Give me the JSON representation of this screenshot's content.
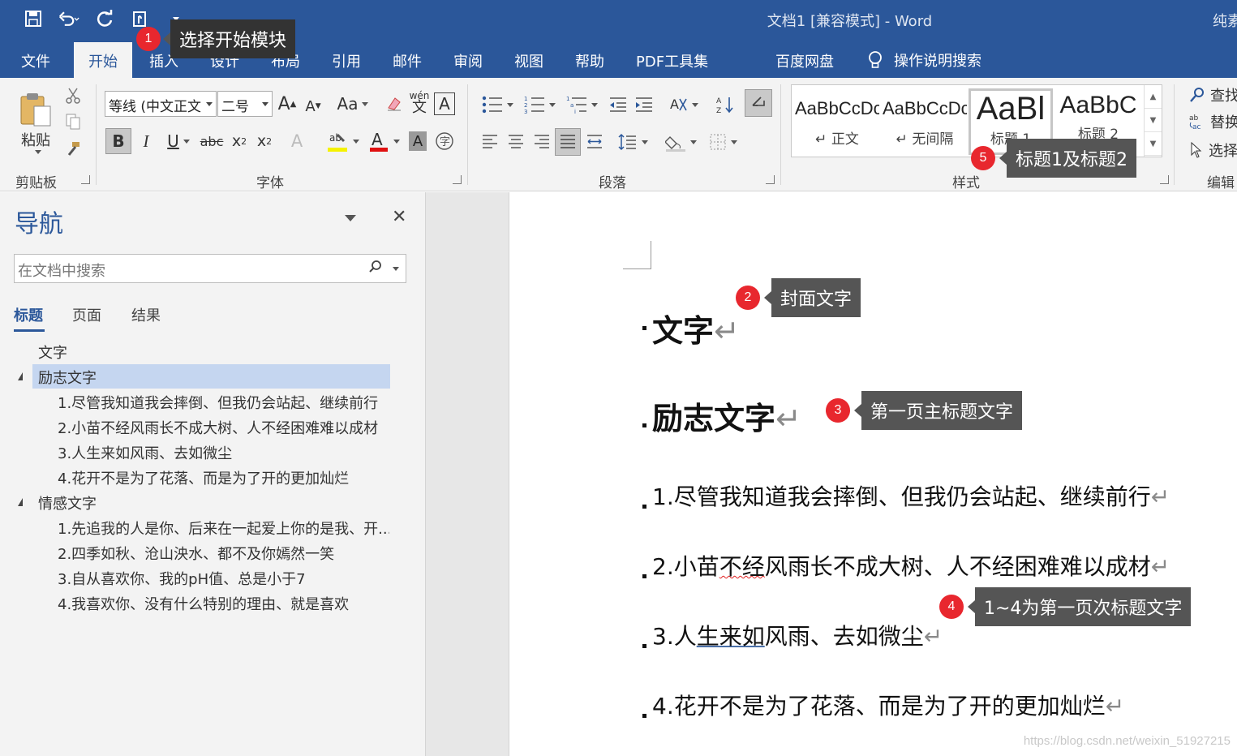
{
  "titlebar": {
    "title": "文档1 [兼容模式] - Word",
    "user": "纯素"
  },
  "tabs": [
    {
      "label": "文件"
    },
    {
      "label": "开始"
    },
    {
      "label": "插入"
    },
    {
      "label": "设计"
    },
    {
      "label": "布局"
    },
    {
      "label": "引用"
    },
    {
      "label": "邮件"
    },
    {
      "label": "审阅"
    },
    {
      "label": "视图"
    },
    {
      "label": "帮助"
    },
    {
      "label": "PDF工具集"
    },
    {
      "label": "百度网盘"
    }
  ],
  "tellme": "操作说明搜索",
  "ribbon": {
    "clipboard": {
      "paste_label": "粘贴",
      "group_label": "剪贴板"
    },
    "font": {
      "font_name": "等线 (中文正文",
      "font_size": "二号",
      "group_label": "字体",
      "change_case": "Aa",
      "phonetic": "wén"
    },
    "paragraph": {
      "group_label": "段落"
    },
    "styles": {
      "group_label": "样式",
      "items": [
        {
          "sample": "AaBbCcDc",
          "name": "↵ 正文"
        },
        {
          "sample": "AaBbCcDc",
          "name": "↵ 无间隔"
        },
        {
          "sample": "AaBl",
          "name": "标题 1"
        },
        {
          "sample": "AaBbC",
          "name": "标题 2"
        }
      ]
    },
    "editing": {
      "find": "查找",
      "replace": "替换",
      "select": "选择",
      "group_label": "编辑"
    }
  },
  "nav": {
    "title": "导航",
    "search_placeholder": "在文档中搜索",
    "tabs": [
      "标题",
      "页面",
      "结果"
    ],
    "tree": [
      {
        "label": "文字"
      },
      {
        "label": "励志文字"
      },
      {
        "label": "1.尽管我知道我会摔倒、但我仍会站起、继续前行"
      },
      {
        "label": "2.小苗不经风雨长不成大树、人不经困难难以成材"
      },
      {
        "label": "3.人生来如风雨、去如微尘"
      },
      {
        "label": "4.花开不是为了花落、而是为了开的更加灿烂"
      },
      {
        "label": "情感文字"
      },
      {
        "label": "1.先追我的人是你、后来在一起爱上你的是我、开..."
      },
      {
        "label": "2.四季如秋、沧山泱水、都不及你嫣然一笑"
      },
      {
        "label": "3.自从喜欢你、我的pH值、总是小于7"
      },
      {
        "label": "4.我喜欢你、没有什么特别的理由、就是喜欢"
      }
    ]
  },
  "document": {
    "line1": "文字",
    "line2": "励志文字",
    "line3": "1.尽管我知道我会摔倒、但我仍会站起、继续前行",
    "line4_a": "2.小苗",
    "line4_b": "不经",
    "line4_c": "风雨长不成大树、人不经困难难以成材",
    "line5_a": "3.人",
    "line5_b": "生来如",
    "line5_c": "风雨、去如微尘",
    "line6": "4.花开不是为了花落、而是为了开的更加灿烂",
    "para_mark": "↵"
  },
  "annotations": [
    {
      "num": "1",
      "text": "选择开始模块"
    },
    {
      "num": "2",
      "text": "封面文字"
    },
    {
      "num": "3",
      "text": "第一页主标题文字"
    },
    {
      "num": "4",
      "text": "1~4为第一页次标题文字"
    },
    {
      "num": "5",
      "text": "标题1及标题2"
    }
  ],
  "watermark": "https://blog.csdn.net/weixin_51927215",
  "colors": {
    "accent": "#2b579a",
    "badge": "#e8272e",
    "callout": "#555555",
    "nav_selected": "#c5d6f0"
  }
}
